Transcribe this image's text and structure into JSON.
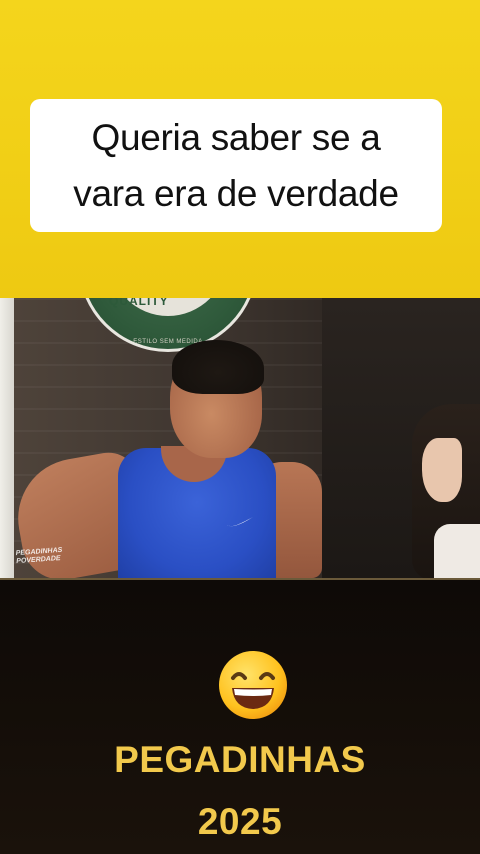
{
  "caption": {
    "line1": "Queria saber se a",
    "line2": "vara era de verdade"
  },
  "video": {
    "logo_text": "PREMIUM QUALITY",
    "logo_subtext": "ESTILO SEM MEDIDA",
    "watermark": "PEGADINHAS POVERDADE",
    "brand_icon": "nike-swoosh-icon"
  },
  "promo": {
    "emoji": "grinning-face-icon",
    "title": "PEGADINHAS",
    "year": "2025"
  },
  "colors": {
    "banner_yellow": "#f1cf16",
    "promo_gold": "#f2c94c",
    "shirt_blue": "#2a4fc4"
  }
}
